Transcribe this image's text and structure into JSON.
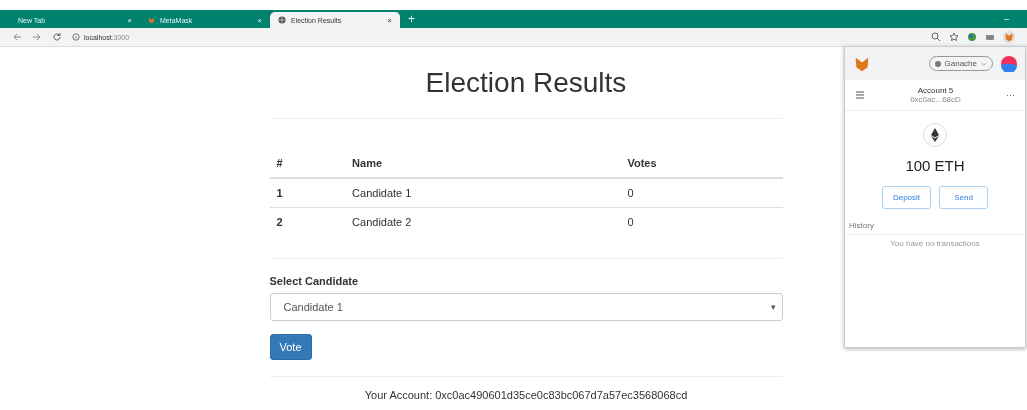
{
  "browser": {
    "tabs": [
      {
        "title": "New Tab",
        "selected": false,
        "kind": "plain",
        "close": "×"
      },
      {
        "title": "MetaMask",
        "selected": false,
        "kind": "fox",
        "close": "×"
      },
      {
        "title": "Election Results",
        "selected": true,
        "kind": "globe",
        "close": "×"
      }
    ],
    "new_tab": "+",
    "window_control": "–",
    "address": {
      "host": "localhost",
      "port": ":3000"
    }
  },
  "page": {
    "title": "Election Results",
    "table": {
      "columns": [
        "#",
        "Name",
        "Votes"
      ],
      "rows": [
        [
          "1",
          "Candidate 1",
          "0"
        ],
        [
          "2",
          "Candidate 2",
          "0"
        ]
      ]
    },
    "select_label": "Select Candidate",
    "select_value": "Candidate 1",
    "caret": "▾",
    "vote_button": "Vote",
    "account": "Your Account: 0xc0ac490601d35ce0c83bc067d7a57ec3568068cd"
  },
  "metamask": {
    "network": "Ganache",
    "account_name": "Account 5",
    "account_address": "0xc0ac...68cD",
    "more": "···",
    "balance": "100 ETH",
    "buttons": [
      "Deposit",
      "Send"
    ],
    "history_label": "History",
    "empty_text": "You have no transactions"
  }
}
